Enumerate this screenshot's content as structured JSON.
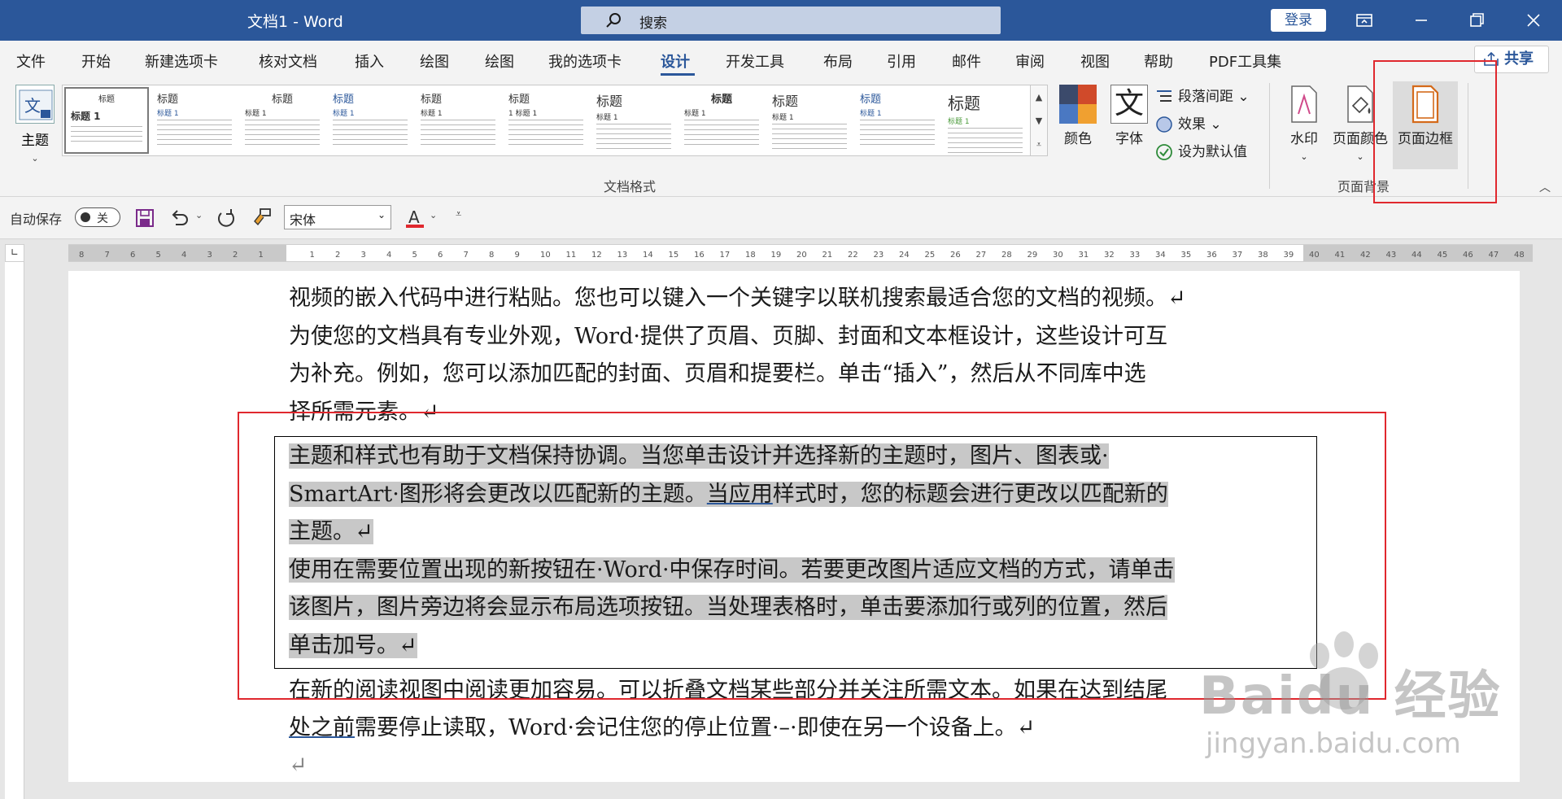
{
  "titlebar": {
    "title": "文档1 - Word",
    "search_placeholder": "搜索",
    "login_label": "登录"
  },
  "tabs": [
    {
      "label": "文件"
    },
    {
      "label": "开始"
    },
    {
      "label": "新建选项卡"
    },
    {
      "label": "核对文档"
    },
    {
      "label": "插入"
    },
    {
      "label": "绘图"
    },
    {
      "label": "绘图"
    },
    {
      "label": "我的选项卡"
    },
    {
      "label": "设计"
    },
    {
      "label": "开发工具"
    },
    {
      "label": "布局"
    },
    {
      "label": "引用"
    },
    {
      "label": "邮件"
    },
    {
      "label": "审阅"
    },
    {
      "label": "视图"
    },
    {
      "label": "帮助"
    },
    {
      "label": "PDF工具集"
    }
  ],
  "active_tab": "设计",
  "share_label": "共享",
  "ribbon": {
    "theme_label": "主题",
    "gallery_styles": [
      {
        "heading": "标题",
        "sub": "标题 1"
      },
      {
        "heading": "标题",
        "sub": "标题 1"
      },
      {
        "heading": "标题",
        "sub": "标题 1"
      },
      {
        "heading": "标题",
        "sub": "标题 1"
      },
      {
        "heading": "标题",
        "sub": "标题 1"
      },
      {
        "heading": "标题",
        "sub": "1 标题 1"
      },
      {
        "heading": "标题",
        "sub": "标题 1"
      },
      {
        "heading": "标题",
        "sub": "标题 1"
      },
      {
        "heading": "标题",
        "sub": "标题 1"
      },
      {
        "heading": "标题",
        "sub": "标题 1"
      },
      {
        "heading": "标题",
        "sub": "标题 1"
      }
    ],
    "colors_label": "颜色",
    "fonts_label": "字体",
    "fonts_icon_char": "文",
    "paragraph_spacing_label": "段落间距",
    "effects_label": "效果",
    "set_default_label": "设为默认值",
    "doc_format_group": "文档格式",
    "watermark_label": "水印",
    "page_color_label": "页面颜色",
    "page_borders_label": "页面边框",
    "page_background_group": "页面背景"
  },
  "qat": {
    "autosave_label": "自动保存",
    "autosave_state": "关",
    "font_name": "宋体"
  },
  "document": {
    "lines": [
      {
        "text": "视频的嵌入代码中进行粘贴。您也可以键入一个关键字以联机搜索最适合您的文档的视频。↵"
      },
      {
        "text": "为使您的文档具有专业外观，Word·提供了页眉、页脚、封面和文本框设计，这些设计可互"
      },
      {
        "text": "为补充。例如，您可以添加匹配的封面、页眉和提要栏。单击“插入”，然后从不同库中选"
      },
      {
        "text": "择所需元素。↵"
      }
    ],
    "bordered_lines": [
      {
        "text": "主题和样式也有助于文档保持协调。当您单击设计并选择新的主题时，图片、图表或·"
      },
      {
        "pre": "SmartArt·图形将会更改以匹配新的主题。",
        "ul": "当应用",
        "post": "样式时，您的标题会进行更改以匹配新的"
      },
      {
        "text": "主题。↵"
      },
      {
        "text": "使用在需要位置出现的新按钮在·Word·中保存时间。若要更改图片适应文档的方式，请单击"
      },
      {
        "text": "该图片，图片旁边将会显示布局选项按钮。当处理表格时，单击要添加行或列的位置，然后"
      },
      {
        "text": "单击加号。↵"
      }
    ],
    "after_lines": [
      {
        "text": "在新的阅读视图中阅读更加容易。可以折叠文档某些部分并关注所需文本。如果在达到结尾"
      },
      {
        "pre": "",
        "ul": "处之前",
        "post": "需要停止读取，Word·会记住您的停止位置·–·即使在另一个设备上。↵"
      },
      {
        "text": "↵"
      }
    ]
  },
  "watermark": {
    "main": "Baidu 经验",
    "url": "jingyan.baidu.com"
  },
  "colors": {
    "word_blue": "#2b579a",
    "annotation_red": "#e0282e",
    "highlight_gray": "#c8c8c8"
  }
}
